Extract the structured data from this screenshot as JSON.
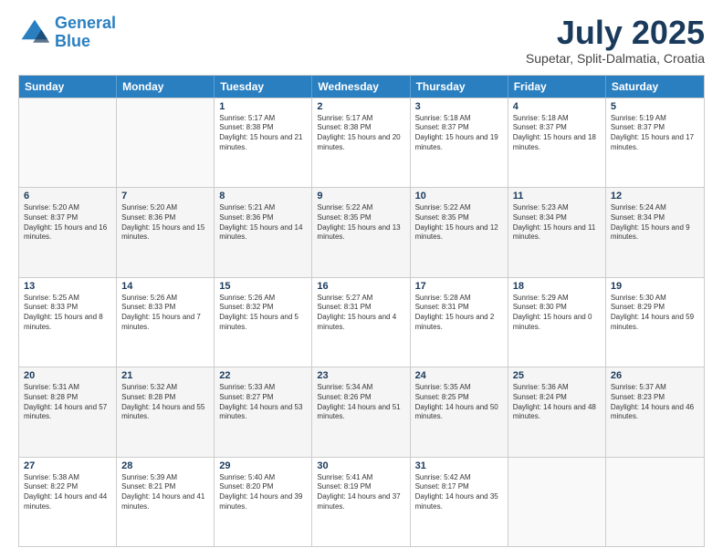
{
  "logo": {
    "line1": "General",
    "line2": "Blue"
  },
  "title": "July 2025",
  "subtitle": "Supetar, Split-Dalmatia, Croatia",
  "header_days": [
    "Sunday",
    "Monday",
    "Tuesday",
    "Wednesday",
    "Thursday",
    "Friday",
    "Saturday"
  ],
  "rows": [
    [
      {
        "day": "",
        "text": ""
      },
      {
        "day": "",
        "text": ""
      },
      {
        "day": "1",
        "text": "Sunrise: 5:17 AM\nSunset: 8:38 PM\nDaylight: 15 hours and 21 minutes."
      },
      {
        "day": "2",
        "text": "Sunrise: 5:17 AM\nSunset: 8:38 PM\nDaylight: 15 hours and 20 minutes."
      },
      {
        "day": "3",
        "text": "Sunrise: 5:18 AM\nSunset: 8:37 PM\nDaylight: 15 hours and 19 minutes."
      },
      {
        "day": "4",
        "text": "Sunrise: 5:18 AM\nSunset: 8:37 PM\nDaylight: 15 hours and 18 minutes."
      },
      {
        "day": "5",
        "text": "Sunrise: 5:19 AM\nSunset: 8:37 PM\nDaylight: 15 hours and 17 minutes."
      }
    ],
    [
      {
        "day": "6",
        "text": "Sunrise: 5:20 AM\nSunset: 8:37 PM\nDaylight: 15 hours and 16 minutes."
      },
      {
        "day": "7",
        "text": "Sunrise: 5:20 AM\nSunset: 8:36 PM\nDaylight: 15 hours and 15 minutes."
      },
      {
        "day": "8",
        "text": "Sunrise: 5:21 AM\nSunset: 8:36 PM\nDaylight: 15 hours and 14 minutes."
      },
      {
        "day": "9",
        "text": "Sunrise: 5:22 AM\nSunset: 8:35 PM\nDaylight: 15 hours and 13 minutes."
      },
      {
        "day": "10",
        "text": "Sunrise: 5:22 AM\nSunset: 8:35 PM\nDaylight: 15 hours and 12 minutes."
      },
      {
        "day": "11",
        "text": "Sunrise: 5:23 AM\nSunset: 8:34 PM\nDaylight: 15 hours and 11 minutes."
      },
      {
        "day": "12",
        "text": "Sunrise: 5:24 AM\nSunset: 8:34 PM\nDaylight: 15 hours and 9 minutes."
      }
    ],
    [
      {
        "day": "13",
        "text": "Sunrise: 5:25 AM\nSunset: 8:33 PM\nDaylight: 15 hours and 8 minutes."
      },
      {
        "day": "14",
        "text": "Sunrise: 5:26 AM\nSunset: 8:33 PM\nDaylight: 15 hours and 7 minutes."
      },
      {
        "day": "15",
        "text": "Sunrise: 5:26 AM\nSunset: 8:32 PM\nDaylight: 15 hours and 5 minutes."
      },
      {
        "day": "16",
        "text": "Sunrise: 5:27 AM\nSunset: 8:31 PM\nDaylight: 15 hours and 4 minutes."
      },
      {
        "day": "17",
        "text": "Sunrise: 5:28 AM\nSunset: 8:31 PM\nDaylight: 15 hours and 2 minutes."
      },
      {
        "day": "18",
        "text": "Sunrise: 5:29 AM\nSunset: 8:30 PM\nDaylight: 15 hours and 0 minutes."
      },
      {
        "day": "19",
        "text": "Sunrise: 5:30 AM\nSunset: 8:29 PM\nDaylight: 14 hours and 59 minutes."
      }
    ],
    [
      {
        "day": "20",
        "text": "Sunrise: 5:31 AM\nSunset: 8:28 PM\nDaylight: 14 hours and 57 minutes."
      },
      {
        "day": "21",
        "text": "Sunrise: 5:32 AM\nSunset: 8:28 PM\nDaylight: 14 hours and 55 minutes."
      },
      {
        "day": "22",
        "text": "Sunrise: 5:33 AM\nSunset: 8:27 PM\nDaylight: 14 hours and 53 minutes."
      },
      {
        "day": "23",
        "text": "Sunrise: 5:34 AM\nSunset: 8:26 PM\nDaylight: 14 hours and 51 minutes."
      },
      {
        "day": "24",
        "text": "Sunrise: 5:35 AM\nSunset: 8:25 PM\nDaylight: 14 hours and 50 minutes."
      },
      {
        "day": "25",
        "text": "Sunrise: 5:36 AM\nSunset: 8:24 PM\nDaylight: 14 hours and 48 minutes."
      },
      {
        "day": "26",
        "text": "Sunrise: 5:37 AM\nSunset: 8:23 PM\nDaylight: 14 hours and 46 minutes."
      }
    ],
    [
      {
        "day": "27",
        "text": "Sunrise: 5:38 AM\nSunset: 8:22 PM\nDaylight: 14 hours and 44 minutes."
      },
      {
        "day": "28",
        "text": "Sunrise: 5:39 AM\nSunset: 8:21 PM\nDaylight: 14 hours and 41 minutes."
      },
      {
        "day": "29",
        "text": "Sunrise: 5:40 AM\nSunset: 8:20 PM\nDaylight: 14 hours and 39 minutes."
      },
      {
        "day": "30",
        "text": "Sunrise: 5:41 AM\nSunset: 8:19 PM\nDaylight: 14 hours and 37 minutes."
      },
      {
        "day": "31",
        "text": "Sunrise: 5:42 AM\nSunset: 8:17 PM\nDaylight: 14 hours and 35 minutes."
      },
      {
        "day": "",
        "text": ""
      },
      {
        "day": "",
        "text": ""
      }
    ]
  ]
}
